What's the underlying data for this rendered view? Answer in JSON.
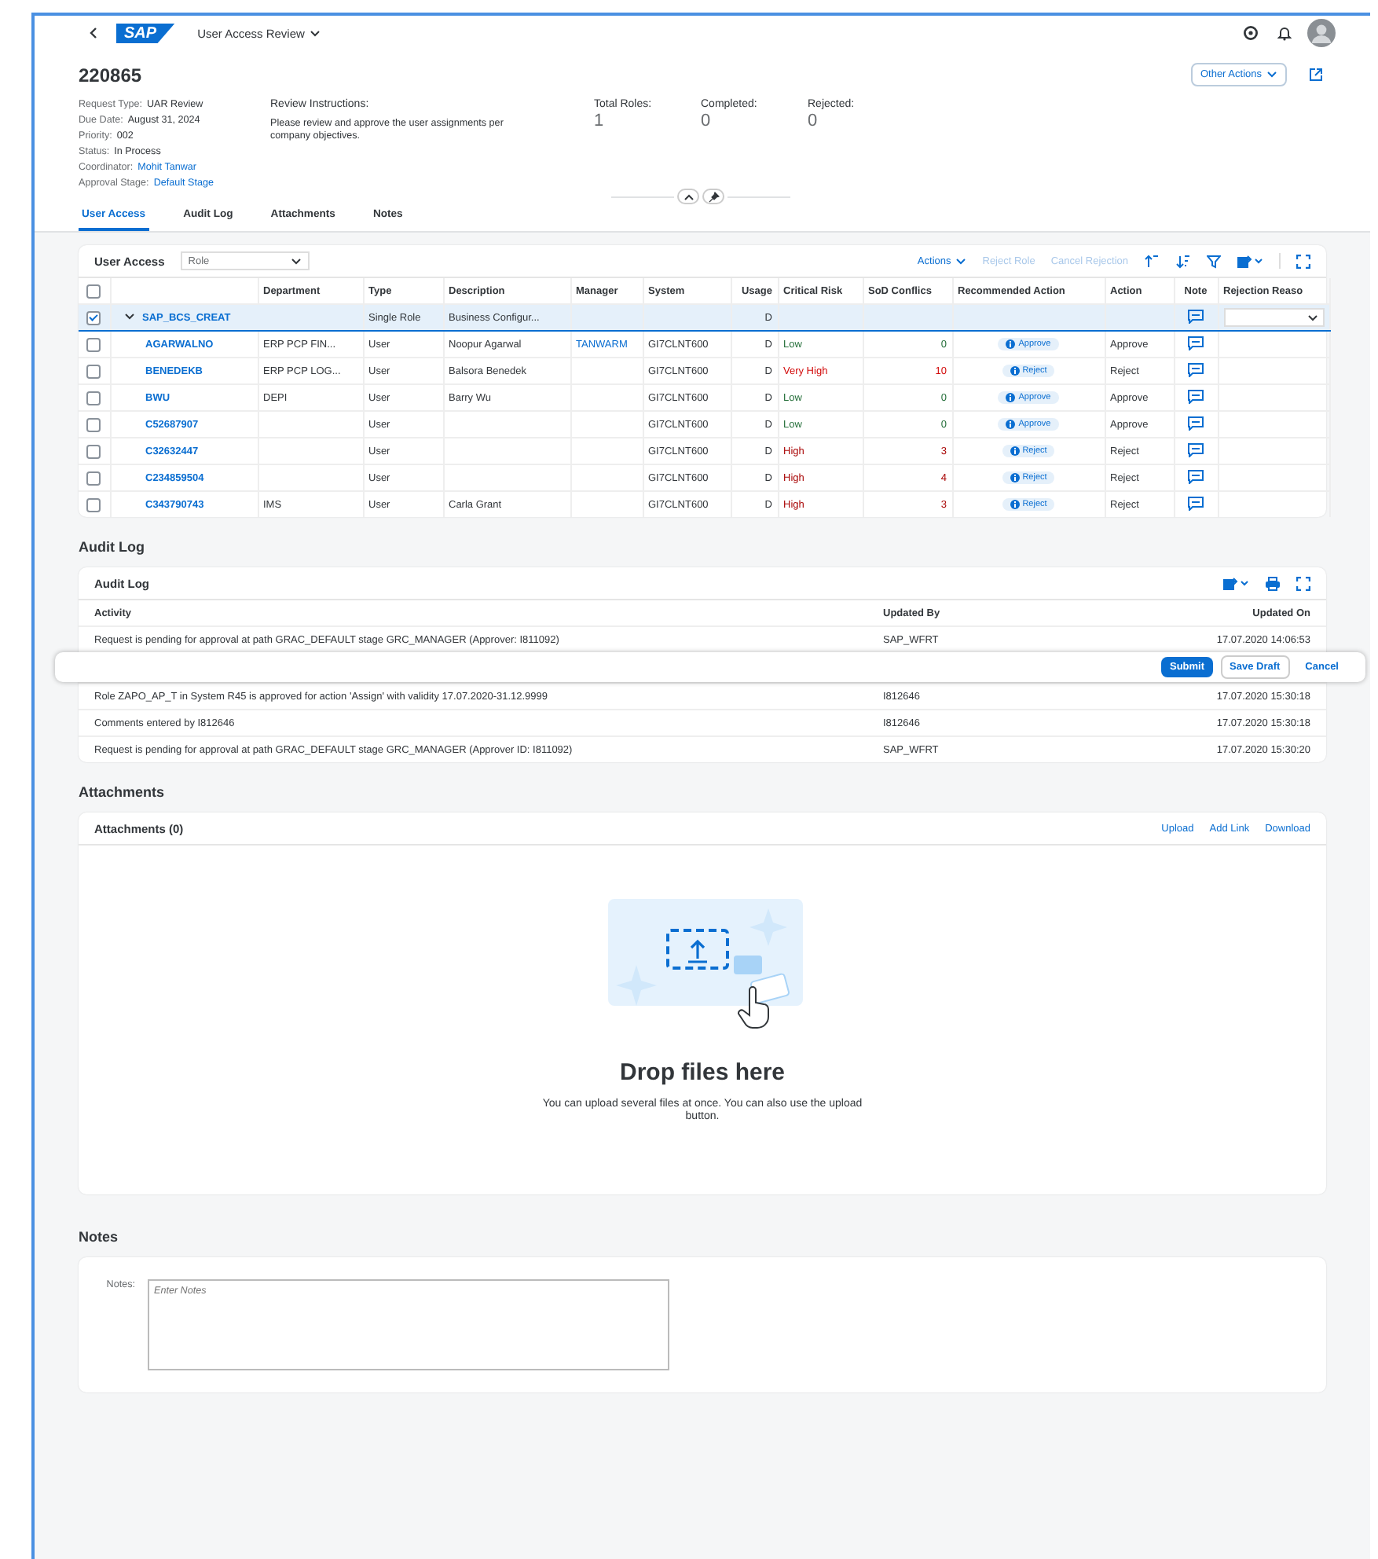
{
  "shell": {
    "logo": "SAP",
    "app_title": "User Access Review"
  },
  "header": {
    "title": "220865",
    "other_actions": "Other Actions",
    "attributes": [
      {
        "label": "Request Type:",
        "value": "UAR Review",
        "kind": "text"
      },
      {
        "label": "Due Date:",
        "value": "August 31, 2024",
        "kind": "text"
      },
      {
        "label": "Priority:",
        "value": "002",
        "kind": "text"
      },
      {
        "label": "Status:",
        "value": "In Process",
        "kind": "text"
      },
      {
        "label": "Coordinator:",
        "value": "Mohit Tanwar",
        "kind": "link"
      },
      {
        "label": "Approval Stage:",
        "value": "Default Stage",
        "kind": "link"
      }
    ],
    "instructions": {
      "label": "Review Instructions:",
      "text": "Please review and approve the user assignments per company objectives."
    },
    "kpis": [
      {
        "label": "Total Roles:",
        "value": "1"
      },
      {
        "label": "Completed:",
        "value": "0"
      },
      {
        "label": "Rejected:",
        "value": "0"
      }
    ]
  },
  "tabs": [
    {
      "label": "User Access",
      "selected": true
    },
    {
      "label": "Audit Log",
      "selected": false
    },
    {
      "label": "Attachments",
      "selected": false
    },
    {
      "label": "Notes",
      "selected": false
    }
  ],
  "user_access": {
    "title": "User Access",
    "filter": {
      "value": "Role"
    },
    "toolbar": [
      {
        "label": "Actions",
        "disabled": false,
        "menu": true
      },
      {
        "label": "Reject Role",
        "disabled": true,
        "menu": false
      },
      {
        "label": "Cancel Rejection",
        "disabled": true,
        "menu": false
      }
    ],
    "select_all": {
      "checked": false
    },
    "columns": [
      "Department",
      "Type",
      "Description",
      "Manager",
      "System",
      "Usage",
      "Critical Risk",
      "SoD Conflics",
      "Recommended Action",
      "Action",
      "Note",
      "Rejection Reaso"
    ],
    "group": {
      "name": "SAP_BCS_CREAT",
      "type": "Single Role",
      "description": "Business Configur...",
      "usage": "D",
      "checked": true,
      "expanded": true,
      "selected": true
    },
    "rows": [
      {
        "name": "AGARWALNO",
        "department": "ERP PCP FIN...",
        "type": "User",
        "description": "Noopur Agarwal",
        "manager": "TANWARM",
        "system": "GI7CLNT600",
        "usage": "D",
        "risk": "Low",
        "color": "#256f3a",
        "sod": "0",
        "recommended": "Approve",
        "action": "Approve",
        "checked": false
      },
      {
        "name": "BENEDEKB",
        "department": "ERP PCP LOG...",
        "type": "User",
        "description": "Balsora Benedek",
        "manager": "",
        "system": "GI7CLNT600",
        "usage": "D",
        "risk": "Very High",
        "color": "#d20a0a",
        "sod": "10",
        "recommended": "Reject",
        "action": "Reject",
        "checked": false
      },
      {
        "name": "BWU",
        "department": "DEPI",
        "type": "User",
        "description": "Barry Wu",
        "manager": "",
        "system": "GI7CLNT600",
        "usage": "D",
        "risk": "Low",
        "color": "#256f3a",
        "sod": "0",
        "recommended": "Approve",
        "action": "Approve",
        "checked": false
      },
      {
        "name": "C52687907",
        "department": "",
        "type": "User",
        "description": "",
        "manager": "",
        "system": "GI7CLNT600",
        "usage": "D",
        "risk": "Low",
        "color": "#256f3a",
        "sod": "0",
        "recommended": "Approve",
        "action": "Approve",
        "checked": false
      },
      {
        "name": "C32632447",
        "department": "",
        "type": "User",
        "description": "",
        "manager": "",
        "system": "GI7CLNT600",
        "usage": "D",
        "risk": "High",
        "color": "#aa0808",
        "sod": "3",
        "recommended": "Reject",
        "action": "Reject",
        "checked": false
      },
      {
        "name": "C234859504",
        "department": "",
        "type": "User",
        "description": "",
        "manager": "",
        "system": "GI7CLNT600",
        "usage": "D",
        "risk": "High",
        "color": "#aa0808",
        "sod": "4",
        "recommended": "Reject",
        "action": "Reject",
        "checked": false
      },
      {
        "name": "C343790743",
        "department": "IMS",
        "type": "User",
        "description": "Carla Grant",
        "manager": "",
        "system": "GI7CLNT600",
        "usage": "D",
        "risk": "High",
        "color": "#aa0808",
        "sod": "3",
        "recommended": "Reject",
        "action": "Reject",
        "checked": false
      }
    ]
  },
  "audit_log": {
    "heading": "Audit Log",
    "title": "Audit Log",
    "columns": [
      "Activity",
      "Updated By",
      "Updated On"
    ],
    "rows": [
      {
        "activity": "Request is pending  for approval at path GRAC_DEFAULT stage GRC_MANAGER (Approver: I811092)",
        "by": "SAP_WFRT",
        "on": "17.07.2020 14:06:53"
      },
      {
        "activity": "Role ZAPO_AP_T in System R45 is approved for action 'Assign' with validity 17.07.2020-31.12.9999",
        "by": "I812646",
        "on": "17.07.2020 15:30:18"
      },
      {
        "activity": "Comments entered by I812646",
        "by": "I812646",
        "on": "17.07.2020 15:30:18"
      },
      {
        "activity": "Request is pending  for approval at path GRAC_DEFAULT stage GRC_MANAGER (Approver ID: I811092)",
        "by": "SAP_WFRT",
        "on": "17.07.2020 15:30:20"
      }
    ]
  },
  "footer": {
    "buttons": [
      {
        "label": "Submit",
        "kind": "emphasized"
      },
      {
        "label": "Save Draft",
        "kind": "default"
      },
      {
        "label": "Cancel",
        "kind": "transparent"
      }
    ]
  },
  "attachments": {
    "heading": "Attachments",
    "title": "Attachments (0)",
    "actions": [
      "Upload",
      "Add Link",
      "Download"
    ],
    "drop_title": "Drop files here",
    "drop_text": "You can upload several files at once. You can also use the upload button."
  },
  "notes": {
    "heading": "Notes",
    "label": "Notes:",
    "placeholder": "Enter Notes"
  }
}
